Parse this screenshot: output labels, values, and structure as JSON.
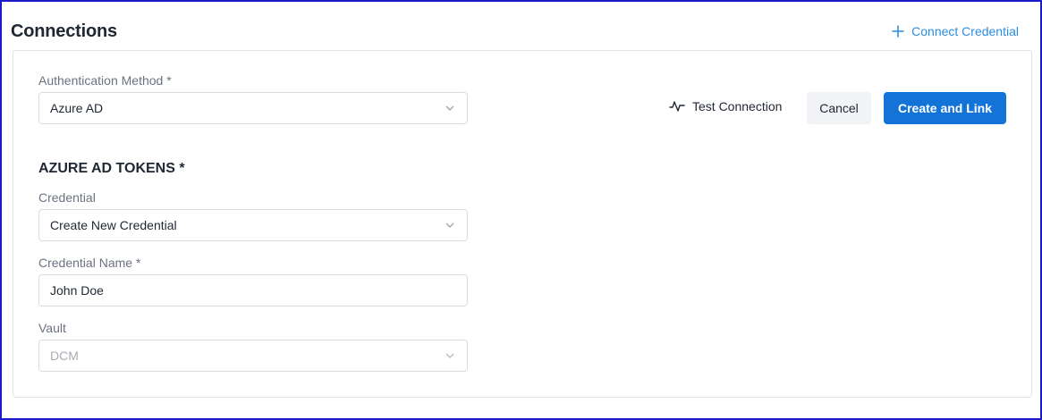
{
  "header": {
    "title": "Connections",
    "connect_credential_label": "Connect Credential"
  },
  "form": {
    "auth_method": {
      "label": "Authentication Method *",
      "value": "Azure AD"
    },
    "section_title": "AZURE AD TOKENS *",
    "credential": {
      "label": "Credential",
      "value": "Create New Credential"
    },
    "credential_name": {
      "label": "Credential Name *",
      "value": "John Doe"
    },
    "vault": {
      "label": "Vault",
      "value": "DCM"
    }
  },
  "actions": {
    "test_connection_label": "Test Connection",
    "cancel_label": "Cancel",
    "create_link_label": "Create and Link"
  },
  "colors": {
    "accent": "#1473d6",
    "link": "#2b8de0",
    "frame_border": "#1a1ac8"
  },
  "icons": {
    "connect": "plus-icon",
    "test": "pulse-icon",
    "dropdown": "chevron-down-icon"
  }
}
